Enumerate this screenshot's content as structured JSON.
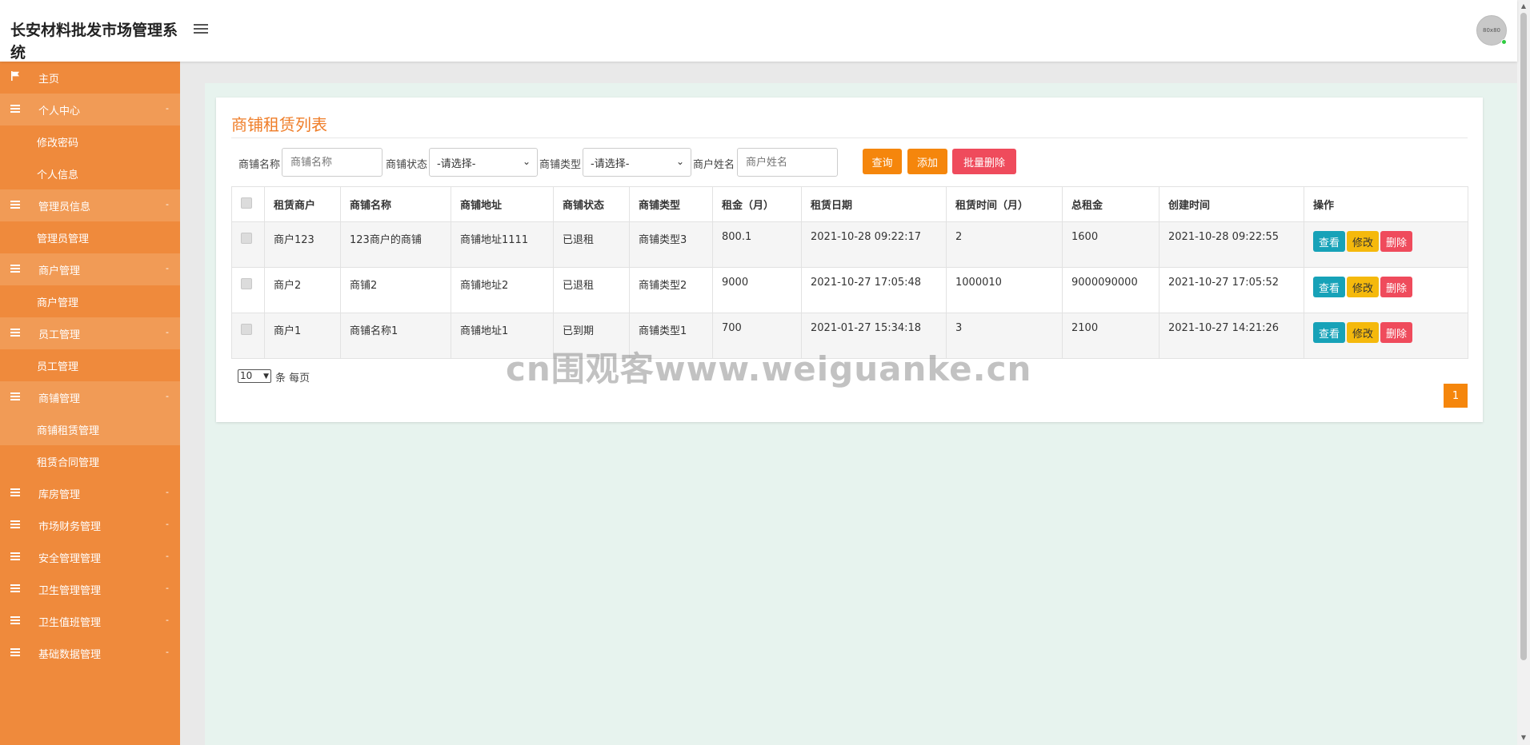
{
  "header": {
    "title": "长安材料批发市场管理系统",
    "avatar_text": "80x80"
  },
  "sidebar": {
    "home": "主页",
    "groups": [
      {
        "label": "个人中心",
        "open": true,
        "children": [
          "修改密码",
          "个人信息"
        ]
      },
      {
        "label": "管理员信息",
        "open": true,
        "children": [
          "管理员管理"
        ]
      },
      {
        "label": "商户管理",
        "open": true,
        "children": [
          "商户管理"
        ]
      },
      {
        "label": "员工管理",
        "open": true,
        "children": [
          "员工管理"
        ]
      },
      {
        "label": "商铺管理",
        "open": true,
        "children": [
          "商铺租赁管理",
          "租赁合同管理"
        ]
      },
      {
        "label": "库房管理",
        "open": false,
        "children": []
      },
      {
        "label": "市场财务管理",
        "open": false,
        "children": []
      },
      {
        "label": "安全管理管理",
        "open": false,
        "children": []
      },
      {
        "label": "卫生管理管理",
        "open": false,
        "children": []
      },
      {
        "label": "卫生值班管理",
        "open": false,
        "children": []
      },
      {
        "label": "基础数据管理",
        "open": false,
        "children": []
      }
    ],
    "arrow": "-"
  },
  "panel": {
    "title": "商铺租赁列表",
    "filters": {
      "shop_name_label": "商铺名称",
      "shop_name_placeholder": "商铺名称",
      "shop_status_label": "商铺状态",
      "shop_status_value": "-请选择-",
      "shop_type_label": "商铺类型",
      "shop_type_value": "-请选择-",
      "merchant_name_label": "商户姓名",
      "merchant_name_placeholder": "商户姓名"
    },
    "buttons": {
      "search": "查询",
      "add": "添加",
      "batch_delete": "批量删除"
    },
    "table": {
      "headers": [
        "租赁商户",
        "商铺名称",
        "商铺地址",
        "商铺状态",
        "商铺类型",
        "租金（月）",
        "租赁日期",
        "租赁时间（月）",
        "总租金",
        "创建时间",
        "操作"
      ],
      "rows": [
        [
          "商户123",
          "123商户的商铺",
          "商铺地址1111",
          "已退租",
          "商铺类型3",
          "800.1",
          "2021-10-28 09:22:17",
          "2",
          "1600",
          "2021-10-28 09:22:55"
        ],
        [
          "商户2",
          "商铺2",
          "商铺地址2",
          "已退租",
          "商铺类型2",
          "9000",
          "2021-10-27 17:05:48",
          "1000010",
          "9000090000",
          "2021-10-27 17:05:52"
        ],
        [
          "商户1",
          "商铺名称1",
          "商铺地址1",
          "已到期",
          "商铺类型1",
          "700",
          "2021-01-27 15:34:18",
          "3",
          "2100",
          "2021-10-27 14:21:26"
        ]
      ],
      "actions": {
        "view": "查看",
        "edit": "修改",
        "delete": "删除"
      }
    },
    "pager": {
      "page_size": "10",
      "per_page_text": "条 每页",
      "current_page": "1"
    }
  },
  "watermark": "cn围观客www.weiguanke.cn",
  "colors": {
    "sidebar": "#ef8a3c",
    "accent": "#f5860c",
    "danger": "#ef4b5c",
    "info": "#17a2b8",
    "warning": "#f5b90c"
  }
}
